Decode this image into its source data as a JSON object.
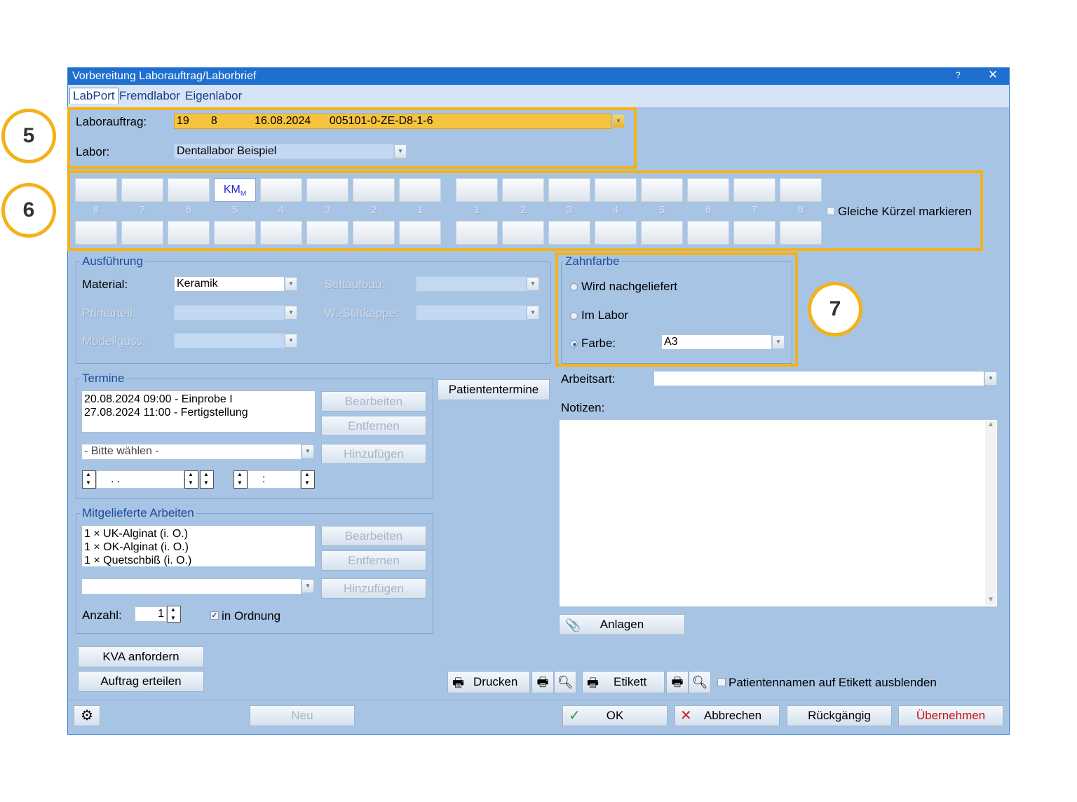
{
  "window": {
    "title": "Vorbereitung Laborauftrag/Laborbrief",
    "help": "?",
    "close": "✕"
  },
  "tabs": [
    "LabPort",
    "Fremdlabor",
    "Eigenlabor"
  ],
  "labor": {
    "auftrag_label": "Laborauftrag:",
    "auftrag_value": "19       8            16.08.2024      005101-0-ZE-D8-1-6",
    "labor_label": "Labor:",
    "labor_value": "Dentallabor Beispiel"
  },
  "teeth": {
    "upper_left": [
      "8",
      "7",
      "6",
      "5",
      "4",
      "3",
      "2",
      "1"
    ],
    "upper_right": [
      "1",
      "2",
      "3",
      "4",
      "5",
      "6",
      "7",
      "8"
    ],
    "selected_main": "KM",
    "selected_sub": "M",
    "same_label": "Gleiche Kürzel markieren"
  },
  "ausfuehrung": {
    "title": "Ausführung",
    "material_label": "Material:",
    "material_value": "Keramik",
    "stiftaufbau_label": "Stiftaufbau:",
    "primaerteil_label": "Primärteil:",
    "wstiftkappe_label": "W.-Stiftkappe:",
    "modellguss_label": "Modellguss:"
  },
  "zahnfarbe": {
    "title": "Zahnfarbe",
    "opt1": "Wird nachgeliefert",
    "opt2": "Im Labor",
    "opt3": "Farbe:",
    "farbe_value": "A3"
  },
  "termine": {
    "title": "Termine",
    "items": [
      "20.08.2024 09:00 - Einprobe I",
      "27.08.2024 11:00 - Fertigstellung"
    ],
    "select": "- Bitte wählen -",
    "date_sep": ".   .",
    "time_sep": ":",
    "btn_edit": "Bearbeiten",
    "btn_remove": "Entfernen",
    "btn_add": "Hinzufügen",
    "btn_patient": "Patiententermine"
  },
  "mitgeliefert": {
    "title": "Mitgelieferte Arbeiten",
    "items": [
      "1 × UK-Alginat  (i. O.)",
      "1 × OK-Alginat  (i. O.)",
      "1 × Quetschbiß  (i. O.)"
    ],
    "btn_edit": "Bearbeiten",
    "btn_remove": "Entfernen",
    "btn_add": "Hinzufügen",
    "anzahl_label": "Anzahl:",
    "anzahl_value": "1",
    "ordnung_label": "in Ordnung",
    "ordnung_check": "✓"
  },
  "right": {
    "arbeitsart_label": "Arbeitsart:",
    "notizen_label": "Notizen:",
    "anlagen": "Anlagen"
  },
  "actions": {
    "kva": "KVA anfordern",
    "auftrag": "Auftrag erteilen",
    "drucken": "Drucken",
    "etikett": "Etikett",
    "hide_names": "Patientennamen auf Etikett ausblenden"
  },
  "footer": {
    "neu": "Neu",
    "ok": "OK",
    "abbrechen": "Abbrechen",
    "rueck": "Rückgängig",
    "uebernehmen": "Übernehmen"
  },
  "callouts": [
    "5",
    "6",
    "7"
  ],
  "colors": {
    "accent": "#f3b21a",
    "titlebar": "#1f6fd0",
    "dialog_bg": "#a8c4e4"
  }
}
